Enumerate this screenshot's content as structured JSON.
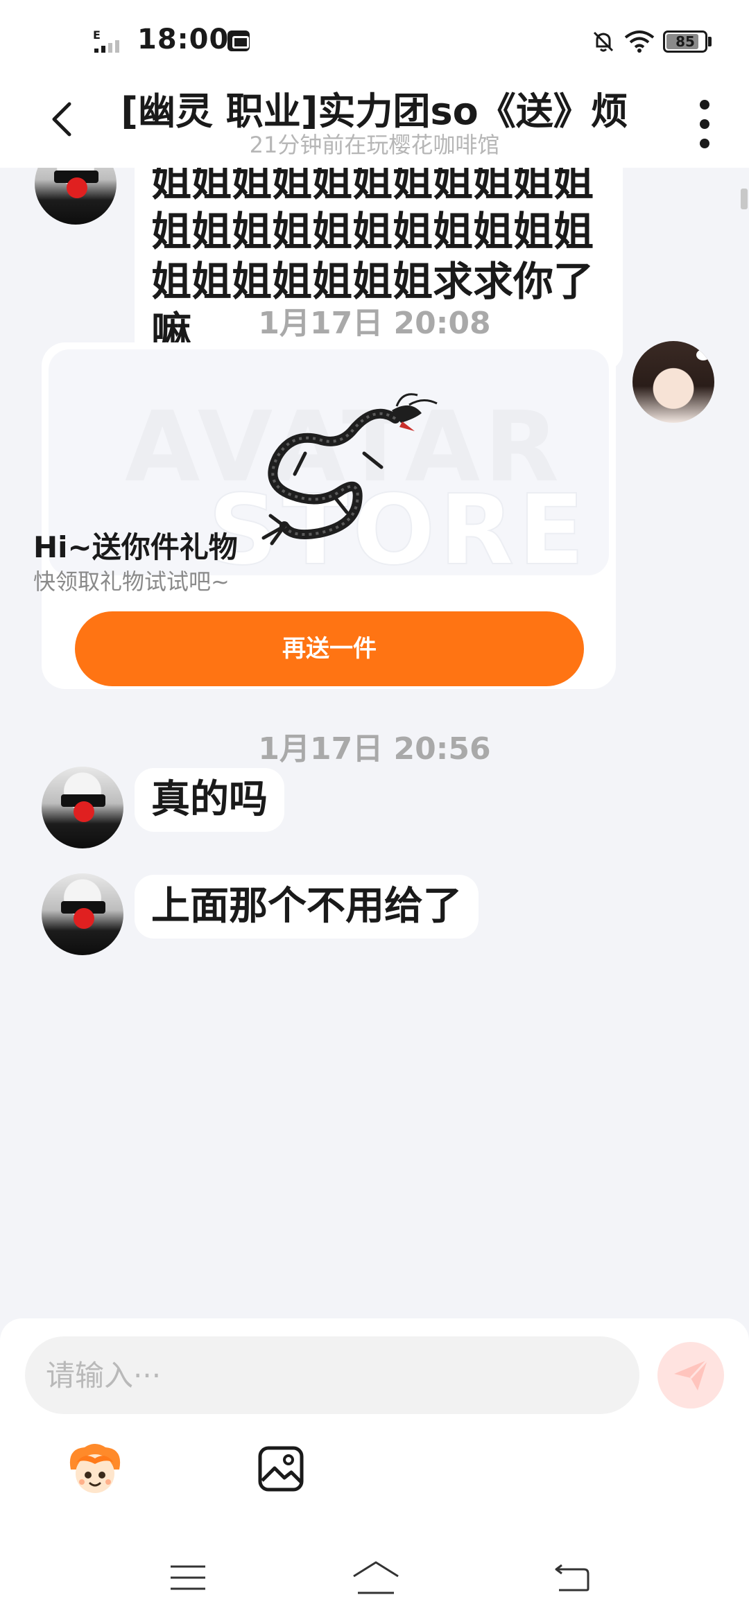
{
  "status_bar": {
    "network_type": "E",
    "time": "18:00",
    "battery": "85"
  },
  "header": {
    "title": "[幽灵 职业]实力团so《送》烦",
    "subtitle": "21分钟前在玩樱花咖啡馆",
    "icons": [
      "back-arrow-icon",
      "more-vertical-icon"
    ]
  },
  "messages": {
    "long_text": "可以送我吗姐姐姐姐姐姐姐姐姐姐姐姐姐姐姐姐姐姐姐姐姐姐姐姐姐姐姐姐姐姐姐姐姐姐姐求求你了嘛",
    "timestamp_1": "1月17日 20:08",
    "gift_card": {
      "watermark_top": "AVATAR",
      "watermark_bottom": "STORE",
      "title": "Hi~送你件礼物",
      "subtitle": "快领取礼物试试吧~",
      "button_label": "再送一件",
      "accent_color": "#ff7413"
    },
    "timestamp_2": "1月17日 20:56",
    "reply_1": "真的吗",
    "reply_2": "上面那个不用给了"
  },
  "input": {
    "placeholder": "请输入···",
    "send_color": "#ffe3e0"
  },
  "toolbar_icons": [
    "emoji-mascot-icon",
    "image-icon"
  ],
  "nav_icons": [
    "menu-icon",
    "home-icon",
    "back-icon"
  ]
}
